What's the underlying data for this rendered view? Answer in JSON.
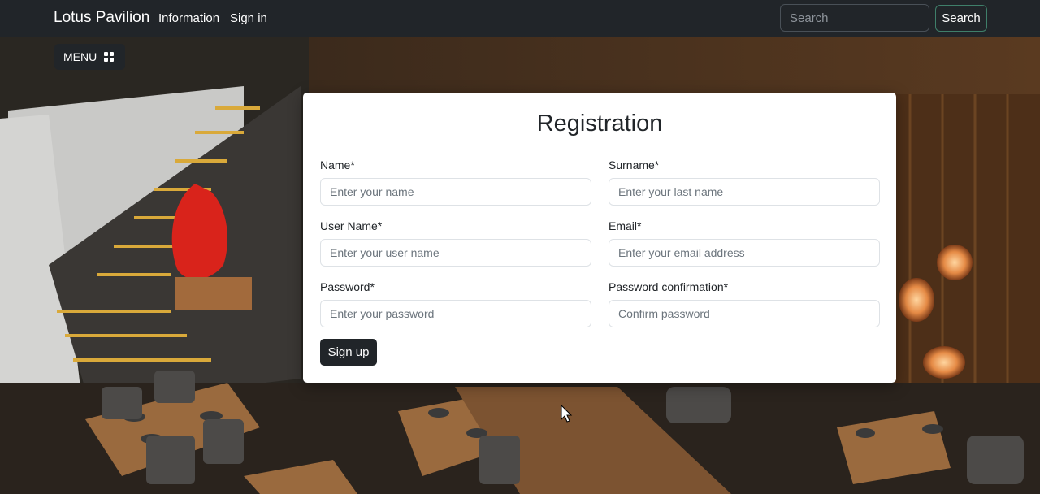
{
  "navbar": {
    "brand": "Lotus Pavilion",
    "links": [
      "Information",
      "Sign in"
    ],
    "search_placeholder": "Search",
    "search_button": "Search"
  },
  "menu_button": {
    "label": "MENU",
    "icon": "grid-icon"
  },
  "registration": {
    "title": "Registration",
    "fields": [
      {
        "label": "Name*",
        "placeholder": "Enter your name"
      },
      {
        "label": "Surname*",
        "placeholder": "Enter your last name"
      },
      {
        "label": "User Name*",
        "placeholder": "Enter your user name"
      },
      {
        "label": "Email*",
        "placeholder": "Enter your email address"
      },
      {
        "label": "Password*",
        "placeholder": "Enter your password"
      },
      {
        "label": "Password confirmation*",
        "placeholder": "Confirm password"
      }
    ],
    "submit_label": "Sign up"
  },
  "colors": {
    "navbar": "#212529",
    "card": "#ffffff",
    "button_dark": "#212529",
    "search_border": "#3f7f6a"
  }
}
